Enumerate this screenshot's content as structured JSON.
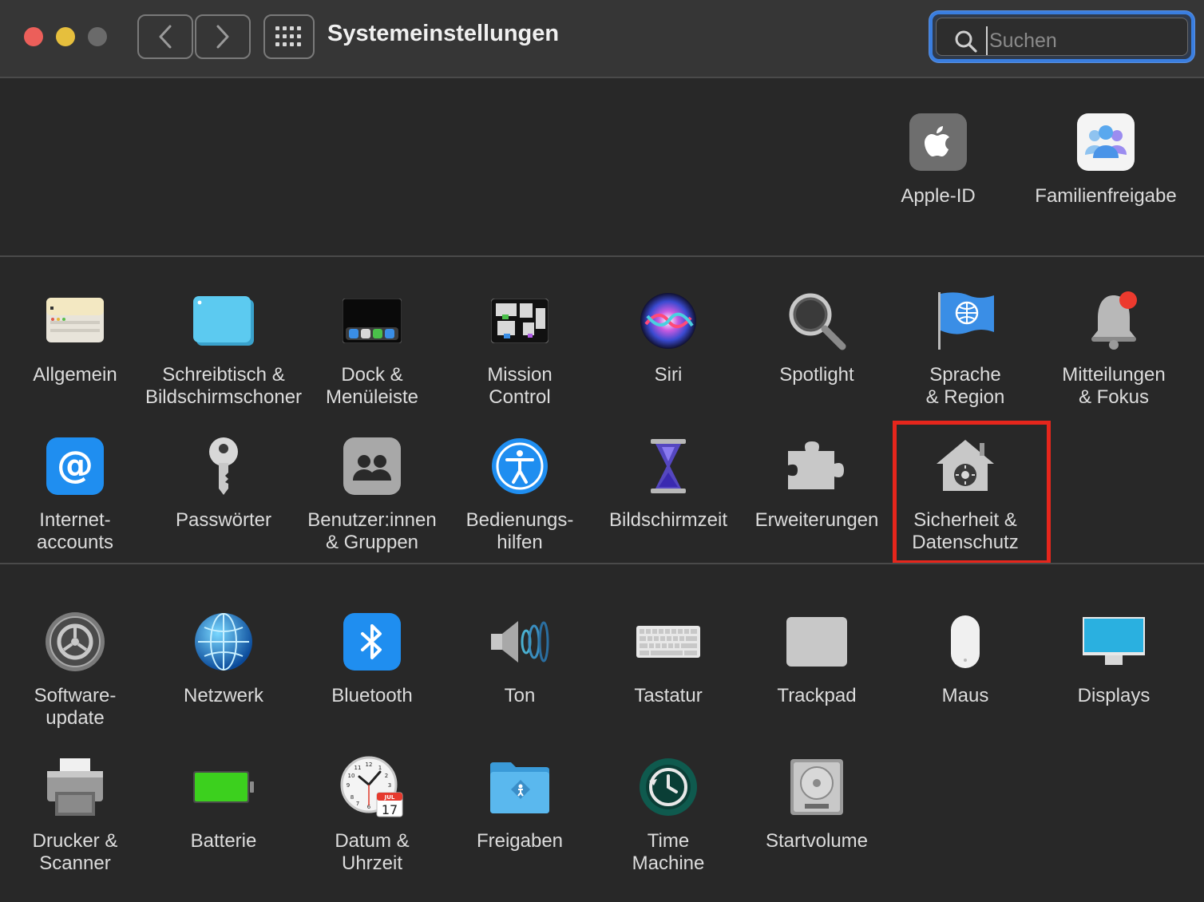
{
  "window": {
    "title": "Systemeinstellungen",
    "search": {
      "placeholder": "Suchen",
      "value": ""
    }
  },
  "account_prefs": [
    {
      "label": "Apple-ID",
      "icon": "apple-id-icon"
    },
    {
      "label": "Familienfreigabe",
      "icon": "family-sharing-icon"
    }
  ],
  "rows": {
    "row1": [
      {
        "label": "Allgemein",
        "icon": "general-icon"
      },
      {
        "label": "Schreibtisch &\nBildschirmschoner",
        "icon": "desktop-screensaver-icon"
      },
      {
        "label": "Dock &\nMenüleiste",
        "icon": "dock-menubar-icon"
      },
      {
        "label": "Mission\nControl",
        "icon": "mission-control-icon"
      },
      {
        "label": "Siri",
        "icon": "siri-icon"
      },
      {
        "label": "Spotlight",
        "icon": "spotlight-icon"
      },
      {
        "label": "Sprache\n& Region",
        "icon": "language-region-icon"
      },
      {
        "label": "Mitteilungen\n& Fokus",
        "icon": "notifications-focus-icon"
      }
    ],
    "row2": [
      {
        "label": "Internet-\naccounts",
        "icon": "internet-accounts-icon"
      },
      {
        "label": "Passwörter",
        "icon": "passwords-icon"
      },
      {
        "label": "Benutzer:innen\n& Gruppen",
        "icon": "users-groups-icon"
      },
      {
        "label": "Bedienungs-\nhilfen",
        "icon": "accessibility-icon"
      },
      {
        "label": "Bildschirmzeit",
        "icon": "screen-time-icon"
      },
      {
        "label": "Erweiterungen",
        "icon": "extensions-icon"
      },
      {
        "label": "Sicherheit &\nDatenschutz",
        "icon": "security-privacy-icon"
      }
    ],
    "row3": [
      {
        "label": "Software-\nupdate",
        "icon": "software-update-icon"
      },
      {
        "label": "Netzwerk",
        "icon": "network-icon"
      },
      {
        "label": "Bluetooth",
        "icon": "bluetooth-icon"
      },
      {
        "label": "Ton",
        "icon": "sound-icon"
      },
      {
        "label": "Tastatur",
        "icon": "keyboard-icon"
      },
      {
        "label": "Trackpad",
        "icon": "trackpad-icon"
      },
      {
        "label": "Maus",
        "icon": "mouse-icon"
      },
      {
        "label": "Displays",
        "icon": "displays-icon"
      }
    ],
    "row4": [
      {
        "label": "Drucker &\nScanner",
        "icon": "printers-scanners-icon"
      },
      {
        "label": "Batterie",
        "icon": "battery-icon"
      },
      {
        "label": "Datum &\nUhrzeit",
        "icon": "date-time-icon"
      },
      {
        "label": "Freigaben",
        "icon": "sharing-icon"
      },
      {
        "label": "Time\nMachine",
        "icon": "time-machine-icon"
      },
      {
        "label": "Startvolume",
        "icon": "startup-disk-icon"
      }
    ]
  },
  "date_icon": {
    "month": "JUL",
    "day": "17"
  },
  "colors": {
    "highlight": "#e6261c",
    "accent": "#3a7ee0"
  }
}
